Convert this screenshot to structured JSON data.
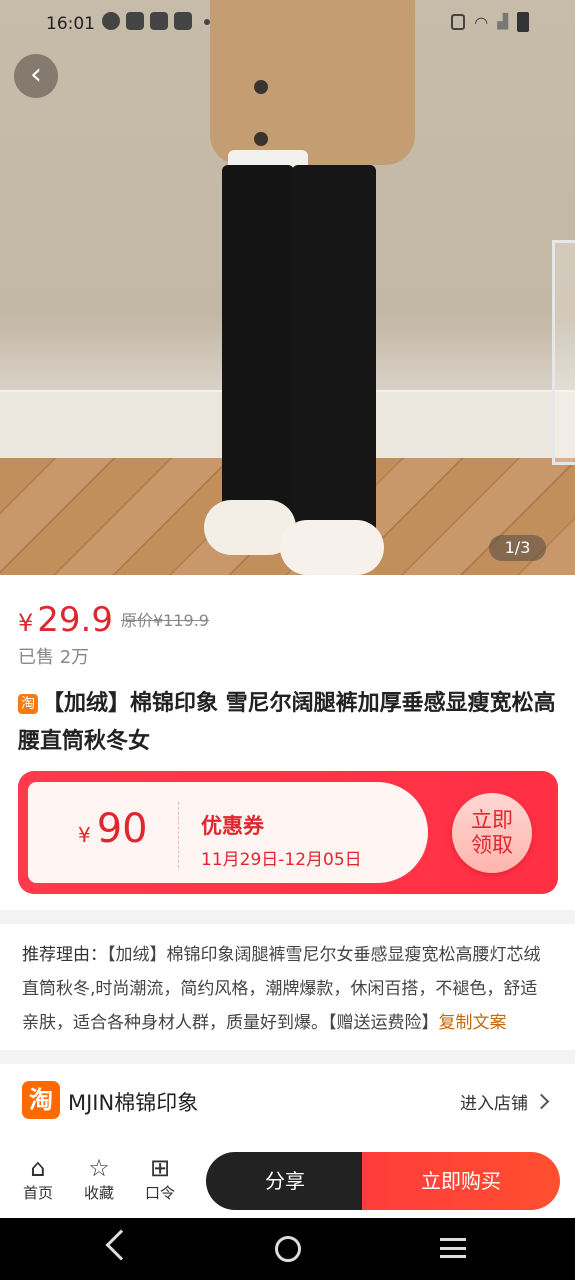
{
  "status_bar": {
    "time": "16:01"
  },
  "hero": {
    "pager": "1/3"
  },
  "product": {
    "price_symbol": "¥",
    "price": "29.9",
    "original_price": "原价¥119.9",
    "sold": "已售 2万",
    "source_badge": "淘",
    "title": "【加绒】棉锦印象 雪尼尔阔腿裤加厚垂感显瘦宽松高腰直筒秋冬女"
  },
  "coupon": {
    "currency": "¥",
    "amount": "90",
    "title": "优惠券",
    "date_range": "11月29日-12月05日",
    "claim_line1": "立即",
    "claim_line2": "领取"
  },
  "recommendation": {
    "label": "推荐理由：",
    "text": "【加绒】棉锦印象阔腿裤雪尼尔女垂感显瘦宽松高腰灯芯绒直筒秋冬,时尚潮流，简约风格，潮牌爆款，休闲百搭，不褪色，舒适亲肤，适合各种身材人群，质量好到爆。【赠送运费险】",
    "copy_link": "复制文案"
  },
  "store": {
    "logo_text": "淘",
    "name": "MJIN棉锦印象",
    "enter": "进入店铺"
  },
  "actions": {
    "home": "首页",
    "favorite": "收藏",
    "token": "口令",
    "share": "分享",
    "buy": "立即购买"
  },
  "colors": {
    "accent": "#e0262f",
    "copy_link": "#c4690e",
    "store_logo": "#ff6a00"
  }
}
